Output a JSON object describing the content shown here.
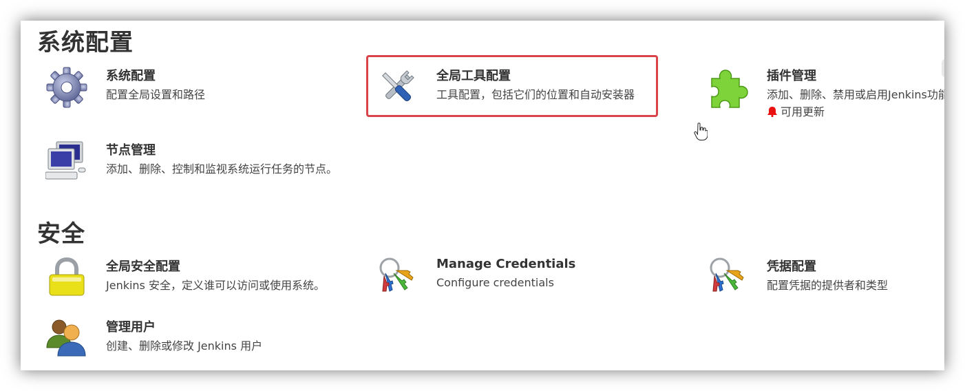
{
  "sections": {
    "system": {
      "title": "系统配置",
      "items": [
        {
          "title": "系统配置",
          "desc": "配置全局设置和路径",
          "icon": "gear-icon"
        },
        {
          "title": "全局工具配置",
          "desc": "工具配置，包括它们的位置和自动安装器",
          "icon": "tools-icon"
        },
        {
          "title": "插件管理",
          "desc": "添加、删除、禁用或启用Jenkins功能",
          "extra": "可用更新",
          "icon": "puzzle-icon"
        },
        {
          "title": "节点管理",
          "desc": "添加、删除、控制和监视系统运行任务的节点。",
          "icon": "computer-icon"
        }
      ]
    },
    "security": {
      "title": "安全",
      "items": [
        {
          "title": "全局安全配置",
          "desc": "Jenkins 安全，定义谁可以访问或使用系统。",
          "icon": "lock-icon"
        },
        {
          "title": "Manage Credentials",
          "desc": "Configure credentials",
          "icon": "keys-icon"
        },
        {
          "title": "凭据配置",
          "desc": "配置凭据的提供者和类型",
          "icon": "keys-icon"
        },
        {
          "title": "管理用户",
          "desc": "创建、删除或修改 Jenkins 用户",
          "icon": "users-icon"
        }
      ]
    }
  },
  "colors": {
    "highlight": "#d9434a",
    "bell": "#e8110f",
    "text": "#333333"
  }
}
